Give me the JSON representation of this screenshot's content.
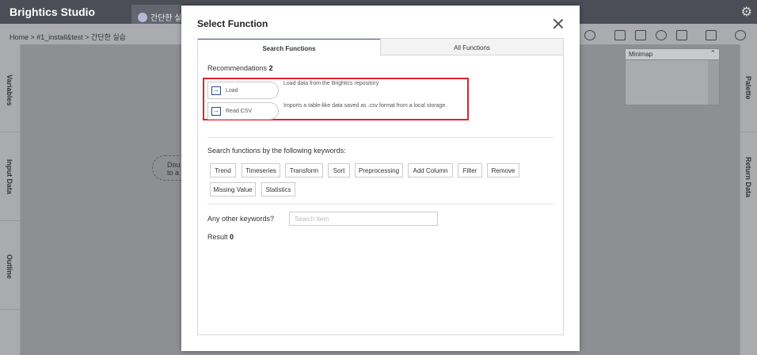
{
  "app": {
    "title": "Brightics Studio",
    "tab_label": "간단한 실습"
  },
  "breadcrumb": "Home > #1_install&test > 간단한 실습",
  "left_panels": [
    "Variables",
    "Input Data",
    "Outline"
  ],
  "right_panels": [
    "Palette",
    "Return Data"
  ],
  "canvas": {
    "node_text_1": "Dou",
    "node_text_2": "to a"
  },
  "minimap": {
    "title": "Minimap"
  },
  "dialog": {
    "title": "Select Function",
    "tabs": [
      "Search Functions",
      "All Functions"
    ],
    "recommendations_label": "Recommendations",
    "recommendations_count": "2",
    "recommendations": [
      {
        "name": "Load",
        "description": "Load data from the Brightics repository"
      },
      {
        "name": "Read CSV",
        "description": "Imports a table-like data saved as .csv format from a local storage."
      }
    ],
    "keywords_label": "Search functions by the following keywords:",
    "keywords": [
      "Trend",
      "Timeseries",
      "Transform",
      "Sort",
      "Preprocessing",
      "Add Column",
      "Filter",
      "Remove",
      "Missing Value",
      "Statistics"
    ],
    "other_label": "Any other keywords?",
    "search_placeholder": "Search Item",
    "result_label": "Result",
    "result_count": "0"
  },
  "colors": {
    "highlight": "#e0232d",
    "accent": "#4863a8",
    "topbar": "#4b4e57"
  },
  "icons": {
    "settings": "gear-icon",
    "close": "close-icon",
    "function": "arrow-into-box-icon"
  }
}
